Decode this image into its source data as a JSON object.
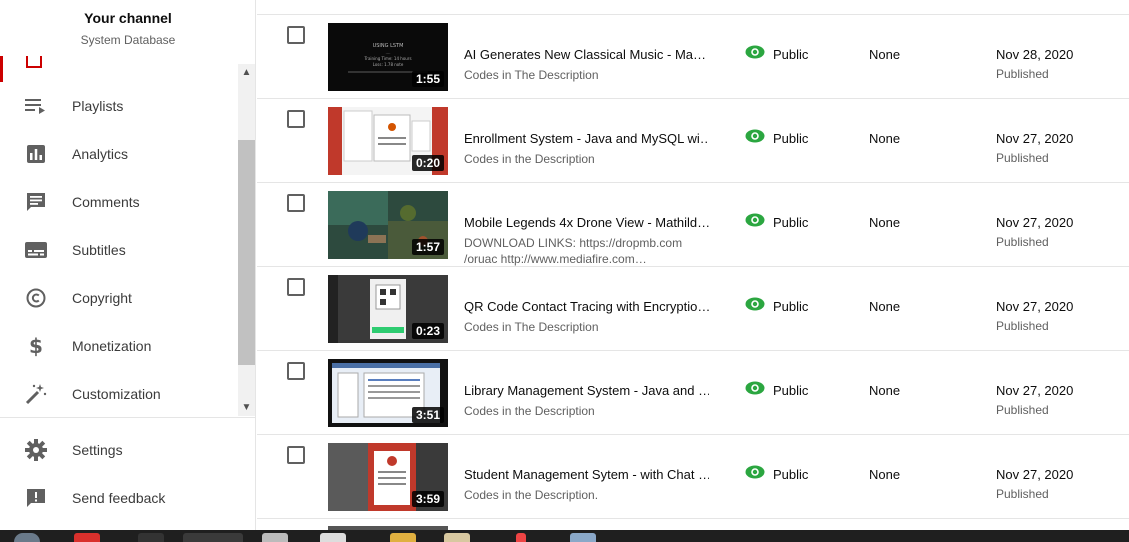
{
  "channel": {
    "title": "Your channel",
    "subtitle": "System Database"
  },
  "sidebar": {
    "items": [
      {
        "label": "Playlists",
        "icon": "playlist-icon"
      },
      {
        "label": "Analytics",
        "icon": "analytics-icon"
      },
      {
        "label": "Comments",
        "icon": "comments-icon"
      },
      {
        "label": "Subtitles",
        "icon": "subtitles-icon"
      },
      {
        "label": "Copyright",
        "icon": "copyright-icon"
      },
      {
        "label": "Monetization",
        "icon": "dollar-icon"
      },
      {
        "label": "Customization",
        "icon": "magic-wand-icon"
      }
    ],
    "bottom": [
      {
        "label": "Settings",
        "icon": "gear-icon"
      },
      {
        "label": "Send feedback",
        "icon": "feedback-icon"
      }
    ],
    "scroll": {
      "up": "▲",
      "down": "▼"
    }
  },
  "videos": [
    {
      "title": "AI Generates New Classical Music - Ma…",
      "desc": "Codes in The Description",
      "duration": "1:55",
      "visibility": "Public",
      "restrictions": "None",
      "date": "Nov 28, 2020",
      "status": "Published"
    },
    {
      "title": "Enrollment System - Java and MySQL wi…",
      "desc": "Codes in the Description",
      "duration": "0:20",
      "visibility": "Public",
      "restrictions": "None",
      "date": "Nov 27, 2020",
      "status": "Published"
    },
    {
      "title": "Mobile Legends 4x Drone View - Mathild…",
      "desc": "DOWNLOAD LINKS: https://dropmb.com /oruac http://www.mediafire.com…",
      "duration": "1:57",
      "visibility": "Public",
      "restrictions": "None",
      "date": "Nov 27, 2020",
      "status": "Published"
    },
    {
      "title": "QR Code Contact Tracing with Encryptio…",
      "desc": "Codes in The Description",
      "duration": "0:23",
      "visibility": "Public",
      "restrictions": "None",
      "date": "Nov 27, 2020",
      "status": "Published"
    },
    {
      "title": "Library Management System - Java and …",
      "desc": "Codes in the Description",
      "duration": "3:51",
      "visibility": "Public",
      "restrictions": "None",
      "date": "Nov 27, 2020",
      "status": "Published"
    },
    {
      "title": "Student Management Sytem - with Chat …",
      "desc": "Codes in the Description.",
      "duration": "3:59",
      "visibility": "Public",
      "restrictions": "None",
      "date": "Nov 27, 2020",
      "status": "Published"
    }
  ],
  "colors": {
    "accent": "#cc0000",
    "visibility": "#2ba640",
    "icon": "#606060"
  }
}
